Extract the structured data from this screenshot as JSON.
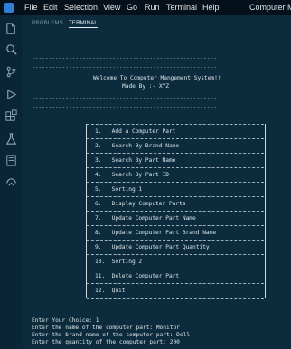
{
  "menubar": {
    "items": [
      "File",
      "Edit",
      "Selection",
      "View",
      "Go",
      "Run",
      "Terminal",
      "Help"
    ],
    "window_title": "Computer Ma"
  },
  "activity_icons": [
    "explorer-icon",
    "search-icon",
    "source-control-icon",
    "run-debug-icon",
    "extensions-icon",
    "testing-icon",
    "notebook-icon",
    "remote-icon"
  ],
  "panel": {
    "tabs": [
      "PROBLEMS",
      "TERMINAL"
    ],
    "active_tab": "TERMINAL"
  },
  "terminal": {
    "rule": "-------------------------------------------------------",
    "welcome": "Welcome To Computer Mangement System!!",
    "made_by": "Made By :- XYZ",
    "menu_separator": "--------------------------------------",
    "menu_items": [
      "1.   Add a Computer Part",
      "2.   Search By Brand Name",
      "3.   Search By Part Name",
      "4.   Search By Part ID",
      "5.   Sorting 1",
      "6.   Display Computer Parts",
      "7.   Update Computer Part Name",
      "8.   Update Computer Part Brand Name",
      "9.   Update Computer Part Quantity",
      "10.  Sorting 2",
      "11.  Delete Computer Part",
      "12.  Quit"
    ],
    "output": [
      "Enter Your Choice: 1",
      "Enter the name of the computer part: Monitor",
      "Enter the brand name of the computer part: Dell",
      "Enter the quantity of the computer part: 200"
    ]
  }
}
